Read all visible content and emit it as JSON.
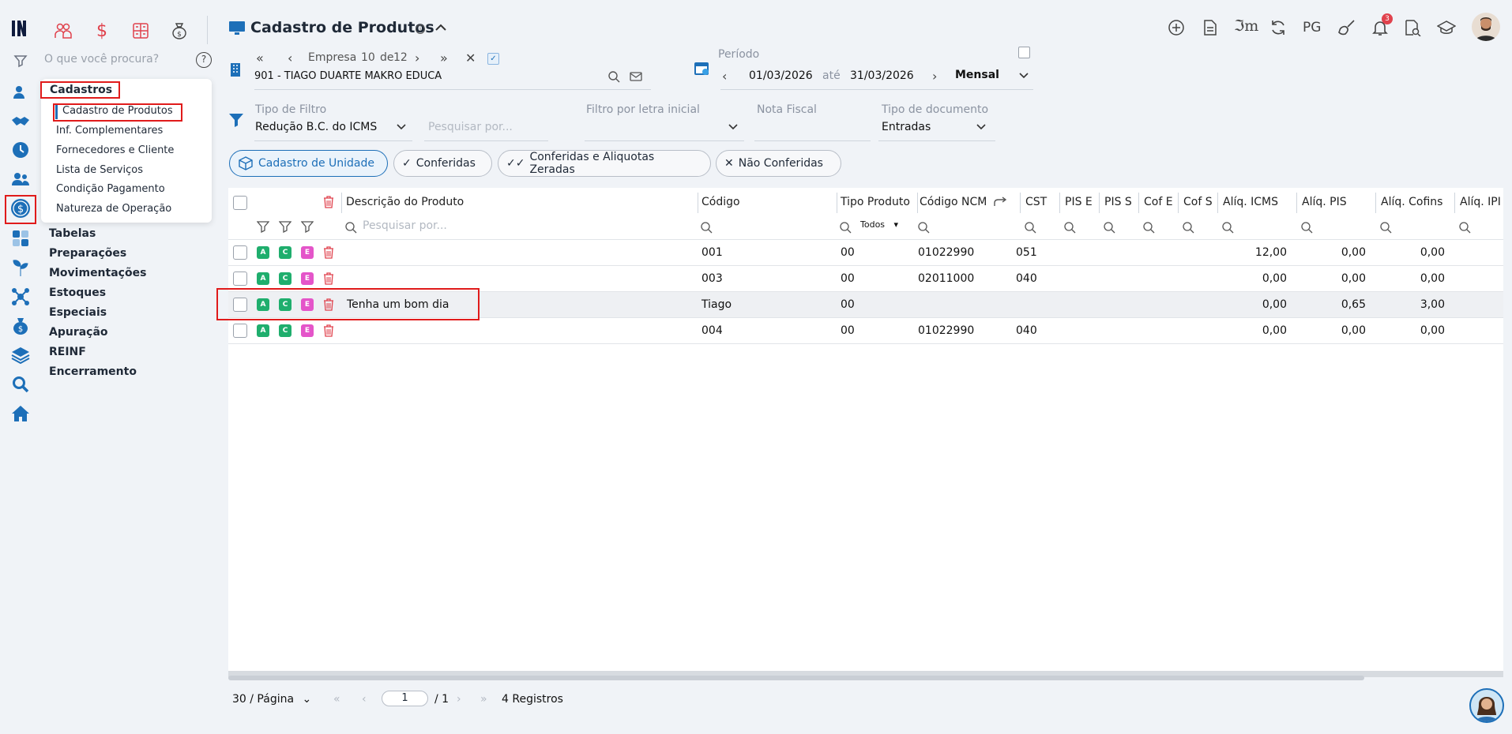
{
  "header": {
    "title": "Cadastro de Produtos",
    "top_icons": [
      "plus-circle-icon",
      "document-icon",
      "im-logo-icon",
      "refresh-icon",
      "pg-label",
      "broom-icon",
      "bell-icon",
      "report-search-icon",
      "graduation-cap-icon"
    ],
    "pg_label": "PG",
    "notification_count": "3"
  },
  "search": {
    "placeholder": "O que você procura?"
  },
  "menu": {
    "title": "Cadastros",
    "items": [
      "Cadastro de Produtos",
      "Inf. Complementares",
      "Fornecedores e Cliente",
      "Lista de Serviços",
      "Condição Pagamento",
      "Natureza de Operação"
    ],
    "sections": [
      "Tabelas",
      "Preparações",
      "Movimentações",
      "Estoques",
      "Especiais",
      "Apuração",
      "REINF",
      "Encerramento"
    ]
  },
  "company": {
    "nav_label": "Empresa",
    "current": "10",
    "of_label": "de",
    "total": "12",
    "name": "901 - TIAGO DUARTE MAKRO EDUCA"
  },
  "period": {
    "label": "Período",
    "start": "01/03/2026",
    "until": "até",
    "end": "31/03/2026",
    "mode": "Mensal"
  },
  "filters": {
    "tipo_filtro_label": "Tipo de Filtro",
    "tipo_filtro_value": "Redução B.C. do ICMS",
    "search_placeholder": "Pesquisar por...",
    "letra_label": "Filtro por letra inicial",
    "nota_label": "Nota Fiscal",
    "tipo_doc_label": "Tipo de documento",
    "tipo_doc_value": "Entradas"
  },
  "chips": [
    "Cadastro de Unidade",
    "Conferidas",
    "Conferidas e Aliquotas Zeradas",
    "Não Conferidas"
  ],
  "table": {
    "columns": [
      "Descrição do Produto",
      "Código",
      "Tipo Produto",
      "Código NCM",
      "CST",
      "PIS E",
      "PIS S",
      "Cof E",
      "Cof S",
      "Alíq. ICMS",
      "Alíq. PIS",
      "Alíq. Cofins",
      "Alíq. IPI"
    ],
    "search_placeholder": "Pesquisar por...",
    "tipo_select": "Todos",
    "badges": [
      "A",
      "C",
      "E"
    ],
    "rows": [
      {
        "descricao": "",
        "codigo": "001",
        "tipo": "00",
        "ncm": "01022990",
        "cst": "051",
        "icms": "12,00",
        "pis": "0,00",
        "cofins": "0,00"
      },
      {
        "descricao": "",
        "codigo": "003",
        "tipo": "00",
        "ncm": "02011000",
        "cst": "040",
        "icms": "0,00",
        "pis": "0,00",
        "cofins": "0,00"
      },
      {
        "descricao": "Tenha um bom dia",
        "codigo": "Tiago",
        "tipo": "00",
        "ncm": "",
        "cst": "",
        "icms": "0,00",
        "pis": "0,65",
        "cofins": "3,00"
      },
      {
        "descricao": "",
        "codigo": "004",
        "tipo": "00",
        "ncm": "01022990",
        "cst": "040",
        "icms": "0,00",
        "pis": "0,00",
        "cofins": "0,00"
      }
    ]
  },
  "pagination": {
    "per_page": "30 / Página",
    "page": "1",
    "total_pages": "/ 1",
    "records": "4 Registros"
  }
}
